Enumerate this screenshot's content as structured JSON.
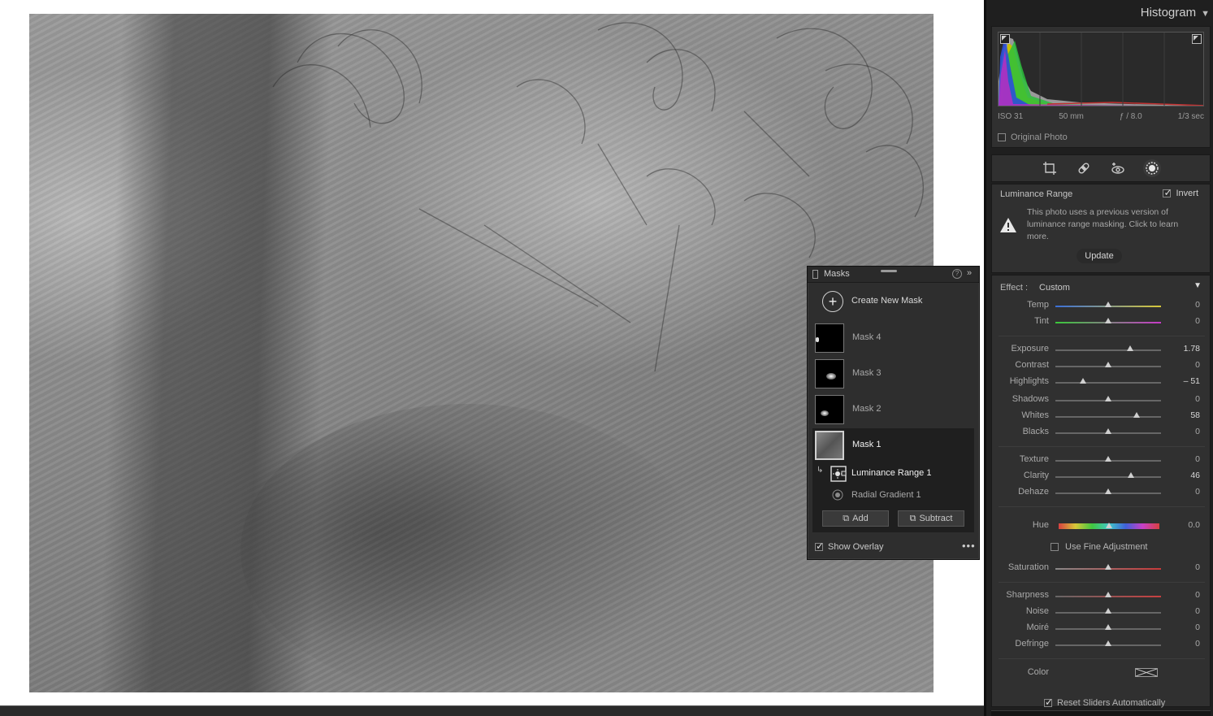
{
  "histogram": {
    "title": "Histogram",
    "exif": {
      "iso": "ISO 31",
      "focal": "50 mm",
      "aperture": "ƒ / 8.0",
      "shutter": "1/3 sec"
    },
    "original_photo_label": "Original Photo"
  },
  "tools": [
    "crop-icon",
    "heal-icon",
    "redeye-icon",
    "masking-icon"
  ],
  "luminance": {
    "title": "Luminance Range",
    "invert_label": "Invert",
    "invert_checked": true,
    "warning": "This photo uses a previous version of luminance range masking. Click to learn more.",
    "update_label": "Update"
  },
  "adjust": {
    "effect_label": "Effect :",
    "effect_value": "Custom",
    "sliders": {
      "temp": {
        "label": "Temp",
        "value": "0"
      },
      "tint": {
        "label": "Tint",
        "value": "0"
      },
      "exposure": {
        "label": "Exposure",
        "value": "1.78"
      },
      "contrast": {
        "label": "Contrast",
        "value": "0"
      },
      "highlights": {
        "label": "Highlights",
        "value": "– 51"
      },
      "shadows": {
        "label": "Shadows",
        "value": "0"
      },
      "whites": {
        "label": "Whites",
        "value": "58"
      },
      "blacks": {
        "label": "Blacks",
        "value": "0"
      },
      "texture": {
        "label": "Texture",
        "value": "0"
      },
      "clarity": {
        "label": "Clarity",
        "value": "46"
      },
      "dehaze": {
        "label": "Dehaze",
        "value": "0"
      },
      "hue": {
        "label": "Hue",
        "value": "0.0"
      },
      "saturation": {
        "label": "Saturation",
        "value": "0"
      },
      "sharpness": {
        "label": "Sharpness",
        "value": "0"
      },
      "noise": {
        "label": "Noise",
        "value": "0"
      },
      "moire": {
        "label": "Moiré",
        "value": "0"
      },
      "defringe": {
        "label": "Defringe",
        "value": "0"
      }
    },
    "fine_adjustment_label": "Use Fine Adjustment",
    "color_label": "Color",
    "reset_label": "Reset Sliders Automatically"
  },
  "masks": {
    "title": "Masks",
    "help": "?",
    "create_label": "Create New Mask",
    "items": [
      {
        "label": "Mask 4"
      },
      {
        "label": "Mask 3"
      },
      {
        "label": "Mask 2"
      },
      {
        "label": "Mask 1"
      }
    ],
    "components": [
      {
        "label": "Luminance Range 1"
      },
      {
        "label": "Radial Gradient 1"
      }
    ],
    "add_label": "Add",
    "subtract_label": "Subtract",
    "show_overlay_label": "Show Overlay",
    "show_overlay_checked": true,
    "more": "•••"
  },
  "colors": {
    "panel_bg": "#303030",
    "panel_dark": "#1f1f1f",
    "selection": "#1f1f1f",
    "canvas_bg": "#ffffff"
  }
}
